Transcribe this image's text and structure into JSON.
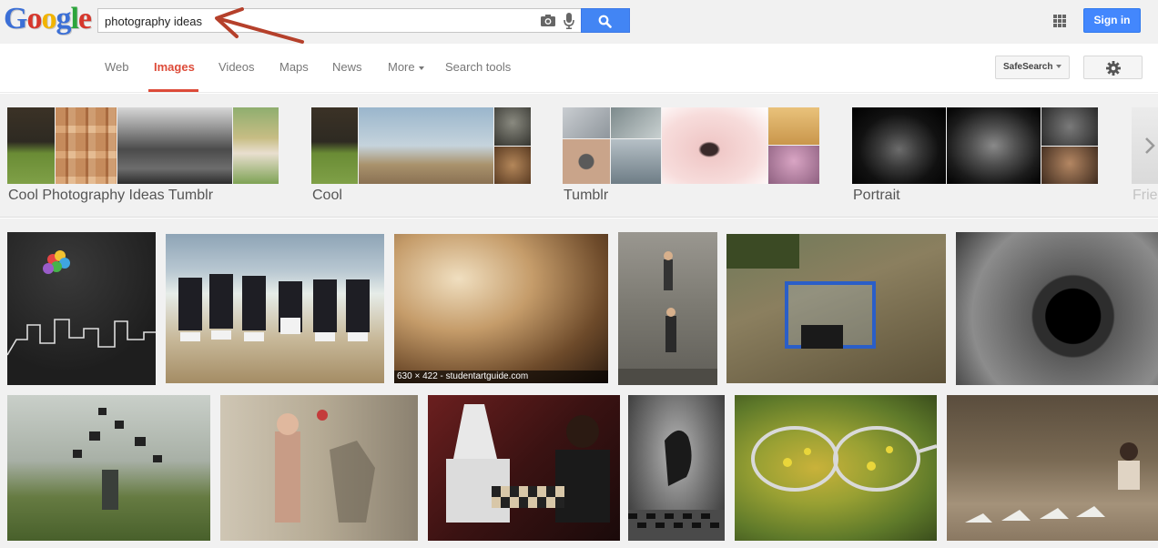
{
  "logo": {
    "text": "Google"
  },
  "search": {
    "query": "photography ideas"
  },
  "header": {
    "sign_in": "Sign in"
  },
  "nav": {
    "tabs": [
      {
        "label": "Web"
      },
      {
        "label": "Images",
        "active": true
      },
      {
        "label": "Videos"
      },
      {
        "label": "Maps"
      },
      {
        "label": "News"
      },
      {
        "label": "More"
      },
      {
        "label": "Search tools"
      }
    ],
    "safesearch": "SafeSearch"
  },
  "related": [
    {
      "label": "Cool Photography Ideas Tumblr"
    },
    {
      "label": "Cool"
    },
    {
      "label": "Tumblr"
    },
    {
      "label": "Portrait"
    },
    {
      "label": "Frie"
    }
  ],
  "results": {
    "hover_caption": "630 × 422 - studentartguide.com"
  },
  "colors": {
    "accent_red": "#dd4b39",
    "search_blue": "#4285f4",
    "signin_blue": "#4387fd",
    "annotation_arrow": "#b5402b"
  }
}
